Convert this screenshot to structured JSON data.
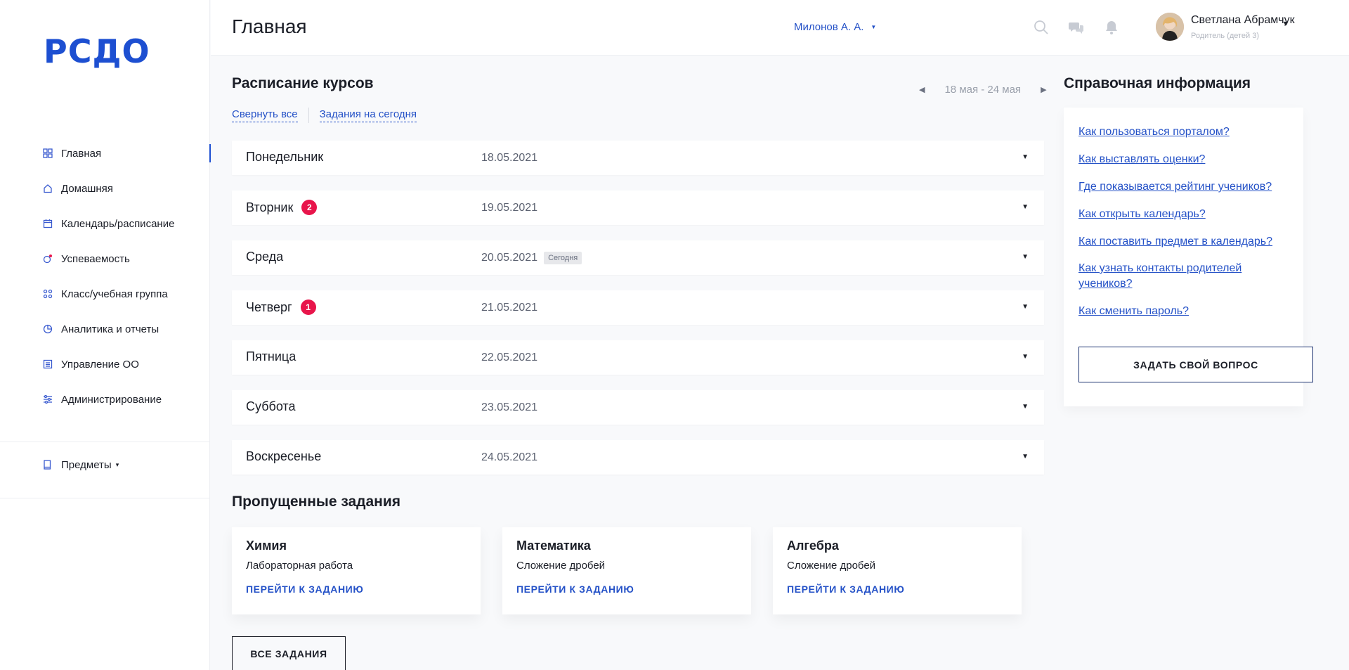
{
  "app": {
    "logo": "РСДО"
  },
  "sidebar": {
    "items": [
      {
        "label": "Главная",
        "icon": "grid-icon",
        "active": true
      },
      {
        "label": "Домашняя",
        "icon": "home-icon"
      },
      {
        "label": "Календарь/расписание",
        "icon": "calendar-icon"
      },
      {
        "label": "Успеваемость",
        "icon": "progress-icon"
      },
      {
        "label": "Класс/учебная группа",
        "icon": "group-icon"
      },
      {
        "label": "Аналитика и отчеты",
        "icon": "chart-pie-icon"
      },
      {
        "label": "Управление ОО",
        "icon": "list-icon"
      },
      {
        "label": "Администрирование",
        "icon": "settings-sliders-icon"
      }
    ],
    "subjects_label": "Предметы"
  },
  "header": {
    "title": "Главная",
    "child_select": "Милонов А. А.",
    "user": {
      "name": "Светлана Абрамчук",
      "role": "Родитель (детей 3)"
    }
  },
  "schedule": {
    "title": "Расписание курсов",
    "collapse_all": "Свернуть все",
    "today_tasks": "Задания на сегодня",
    "week_range": "18 мая - 24 мая",
    "today_tag": "Сегодня",
    "days": [
      {
        "name": "Понедельник",
        "date": "18.05.2021",
        "badge": ""
      },
      {
        "name": "Вторник",
        "date": "19.05.2021",
        "badge": "2"
      },
      {
        "name": "Среда",
        "date": "20.05.2021",
        "badge": ""
      },
      {
        "name": "Четверг",
        "date": "21.05.2021",
        "badge": "1"
      },
      {
        "name": "Пятница",
        "date": "22.05.2021",
        "badge": ""
      },
      {
        "name": "Суббота",
        "date": "23.05.2021",
        "badge": ""
      },
      {
        "name": "Воскресенье",
        "date": "24.05.2021",
        "badge": ""
      }
    ]
  },
  "missed": {
    "title": "Пропущенные задания",
    "cards": [
      {
        "subject": "Химия",
        "desc": "Лабораторная работа",
        "link": "ПЕРЕЙТИ К ЗАДАНИЮ"
      },
      {
        "subject": "Математика",
        "desc": "Сложение дробей",
        "link": "ПЕРЕЙТИ К ЗАДАНИЮ"
      },
      {
        "subject": "Алгебра",
        "desc": "Сложение дробей",
        "link": "ПЕРЕЙТИ К ЗАДАНИЮ"
      }
    ],
    "all_button": "ВСЕ ЗАДАНИЯ"
  },
  "reference": {
    "title": "Справочная информация",
    "links": [
      "Как пользоваться порталом?",
      "Как выставлять оценки?",
      "Где показывается рейтинг учеников?",
      "Как открыть календарь?",
      "Как поставить предмет в календарь?",
      "Как узнать контакты родителей учеников?",
      "Как сменить пароль?"
    ],
    "ask_button": "ЗАДАТЬ СВОЙ ВОПРОС"
  },
  "colors": {
    "accent": "#2451c7",
    "logo": "#1d4fd1",
    "badge": "#e8154b"
  }
}
